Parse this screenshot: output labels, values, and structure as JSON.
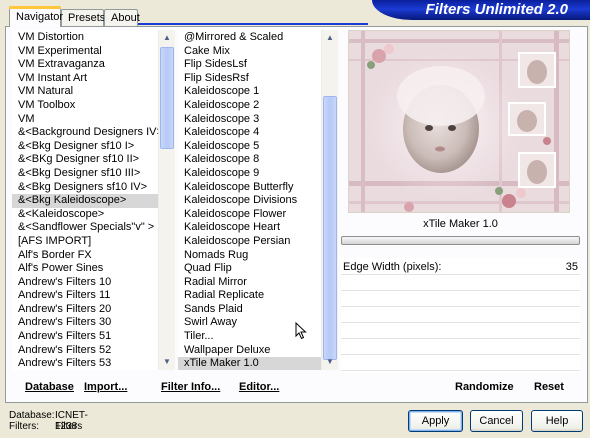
{
  "tabs": [
    {
      "label": "Navigator",
      "active": true
    },
    {
      "label": "Presets",
      "active": false
    },
    {
      "label": "About",
      "active": false
    }
  ],
  "title": "Filters Unlimited 2.0",
  "categories": {
    "items": [
      "VM Distortion",
      "VM Experimental",
      "VM Extravaganza",
      "VM Instant Art",
      "VM Natural",
      "VM Toolbox",
      "VM",
      "&<Background Designers IV>",
      "&<Bkg Designer sf10 I>",
      "&<BKg Designer sf10 II>",
      "&<Bkg Designer sf10 III>",
      "&<Bkg Designers sf10 IV>",
      "&<Bkg Kaleidoscope>",
      "&<Kaleidoscope>",
      "&<Sandflower Specials\"v\" >",
      "[AFS IMPORT]",
      "Alf's Border FX",
      "Alf's Power Sines",
      "Andrew's Filters 10",
      "Andrew's Filters 11",
      "Andrew's Filters 20",
      "Andrew's Filters 30",
      "Andrew's Filters 51",
      "Andrew's Filters 52",
      "Andrew's Filters 53"
    ],
    "selected": "&<Bkg Kaleidoscope>"
  },
  "filters": {
    "items": [
      "@Mirrored & Scaled",
      "Cake Mix",
      "Flip SidesLsf",
      "Flip SidesRsf",
      "Kaleidoscope 1",
      "Kaleidoscope 2",
      "Kaleidoscope 3",
      "Kaleidoscope 4",
      "Kaleidoscope 5",
      "Kaleidoscope 8",
      "Kaleidoscope 9",
      "Kaleidoscope Butterfly",
      "Kaleidoscope Divisions",
      "Kaleidoscope Flower",
      "Kaleidoscope Heart",
      "Kaleidoscope Persian",
      "Nomads Rug",
      "Quad Flip",
      "Radial Mirror",
      "Radial Replicate",
      "Sands Plaid",
      "Swirl Away",
      "Tiler...",
      "Wallpaper Deluxe",
      "xTile Maker 1.0"
    ],
    "selected": "xTile Maker 1.0"
  },
  "buttons": {
    "database": "Database",
    "import": "Import...",
    "filter_info": "Filter Info...",
    "editor": "Editor...",
    "randomize": "Randomize",
    "reset": "Reset",
    "apply": "Apply",
    "cancel": "Cancel",
    "help": "Help"
  },
  "filter_name": "xTile Maker 1.0",
  "params": [
    {
      "label": "Edge Width (pixels):",
      "value": "35"
    }
  ],
  "status": {
    "database_label": "Database:",
    "database_value": "ICNET-Filters",
    "filters_label": "Filters:",
    "filters_value": "1238"
  },
  "colors": {
    "title_bar": "#1b3bd4",
    "tab_highlight": "#ffc83c",
    "selection": "#d7d7d7",
    "button_border": "#003c74"
  }
}
